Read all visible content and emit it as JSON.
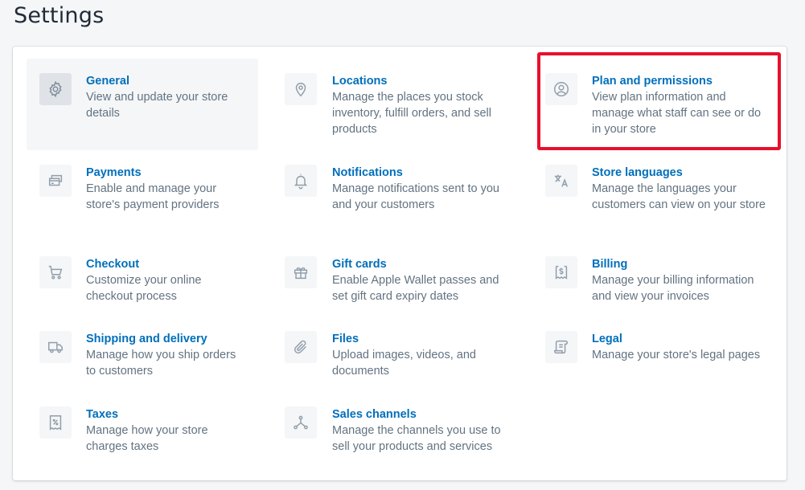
{
  "page": {
    "title": "Settings"
  },
  "settings": [
    {
      "title": "General",
      "desc": "View and update your store details",
      "icon": "gear-icon"
    },
    {
      "title": "Locations",
      "desc": "Manage the places you stock inventory, fulfill orders, and sell products",
      "icon": "location-pin-icon"
    },
    {
      "title": "Plan and permissions",
      "desc": "View plan information and manage what staff can see or do in your store",
      "icon": "user-circle-icon"
    },
    {
      "title": "Payments",
      "desc": "Enable and manage your store's payment providers",
      "icon": "credit-card-icon"
    },
    {
      "title": "Notifications",
      "desc": "Manage notifications sent to you and your customers",
      "icon": "bell-icon"
    },
    {
      "title": "Store languages",
      "desc": "Manage the languages your customers can view on your store",
      "icon": "translate-icon"
    },
    {
      "title": "Checkout",
      "desc": "Customize your online checkout process",
      "icon": "cart-icon"
    },
    {
      "title": "Gift cards",
      "desc": "Enable Apple Wallet passes and set gift card expiry dates",
      "icon": "gift-icon"
    },
    {
      "title": "Billing",
      "desc": "Manage your billing information and view your invoices",
      "icon": "receipt-dollar-icon"
    },
    {
      "title": "Shipping and delivery",
      "desc": "Manage how you ship orders to customers",
      "icon": "truck-icon"
    },
    {
      "title": "Files",
      "desc": "Upload images, videos, and documents",
      "icon": "paperclip-icon"
    },
    {
      "title": "Legal",
      "desc": "Manage your store's legal pages",
      "icon": "document-icon"
    },
    {
      "title": "Taxes",
      "desc": "Manage how your store charges taxes",
      "icon": "tax-percent-icon"
    },
    {
      "title": "Sales channels",
      "desc": "Manage the channels you use to sell your products and services",
      "icon": "channels-icon"
    }
  ],
  "colors": {
    "link": "#006fbb",
    "description": "#637381",
    "icon": "#919eab",
    "highlight": "#e8102e",
    "background": "#f4f6f8"
  }
}
